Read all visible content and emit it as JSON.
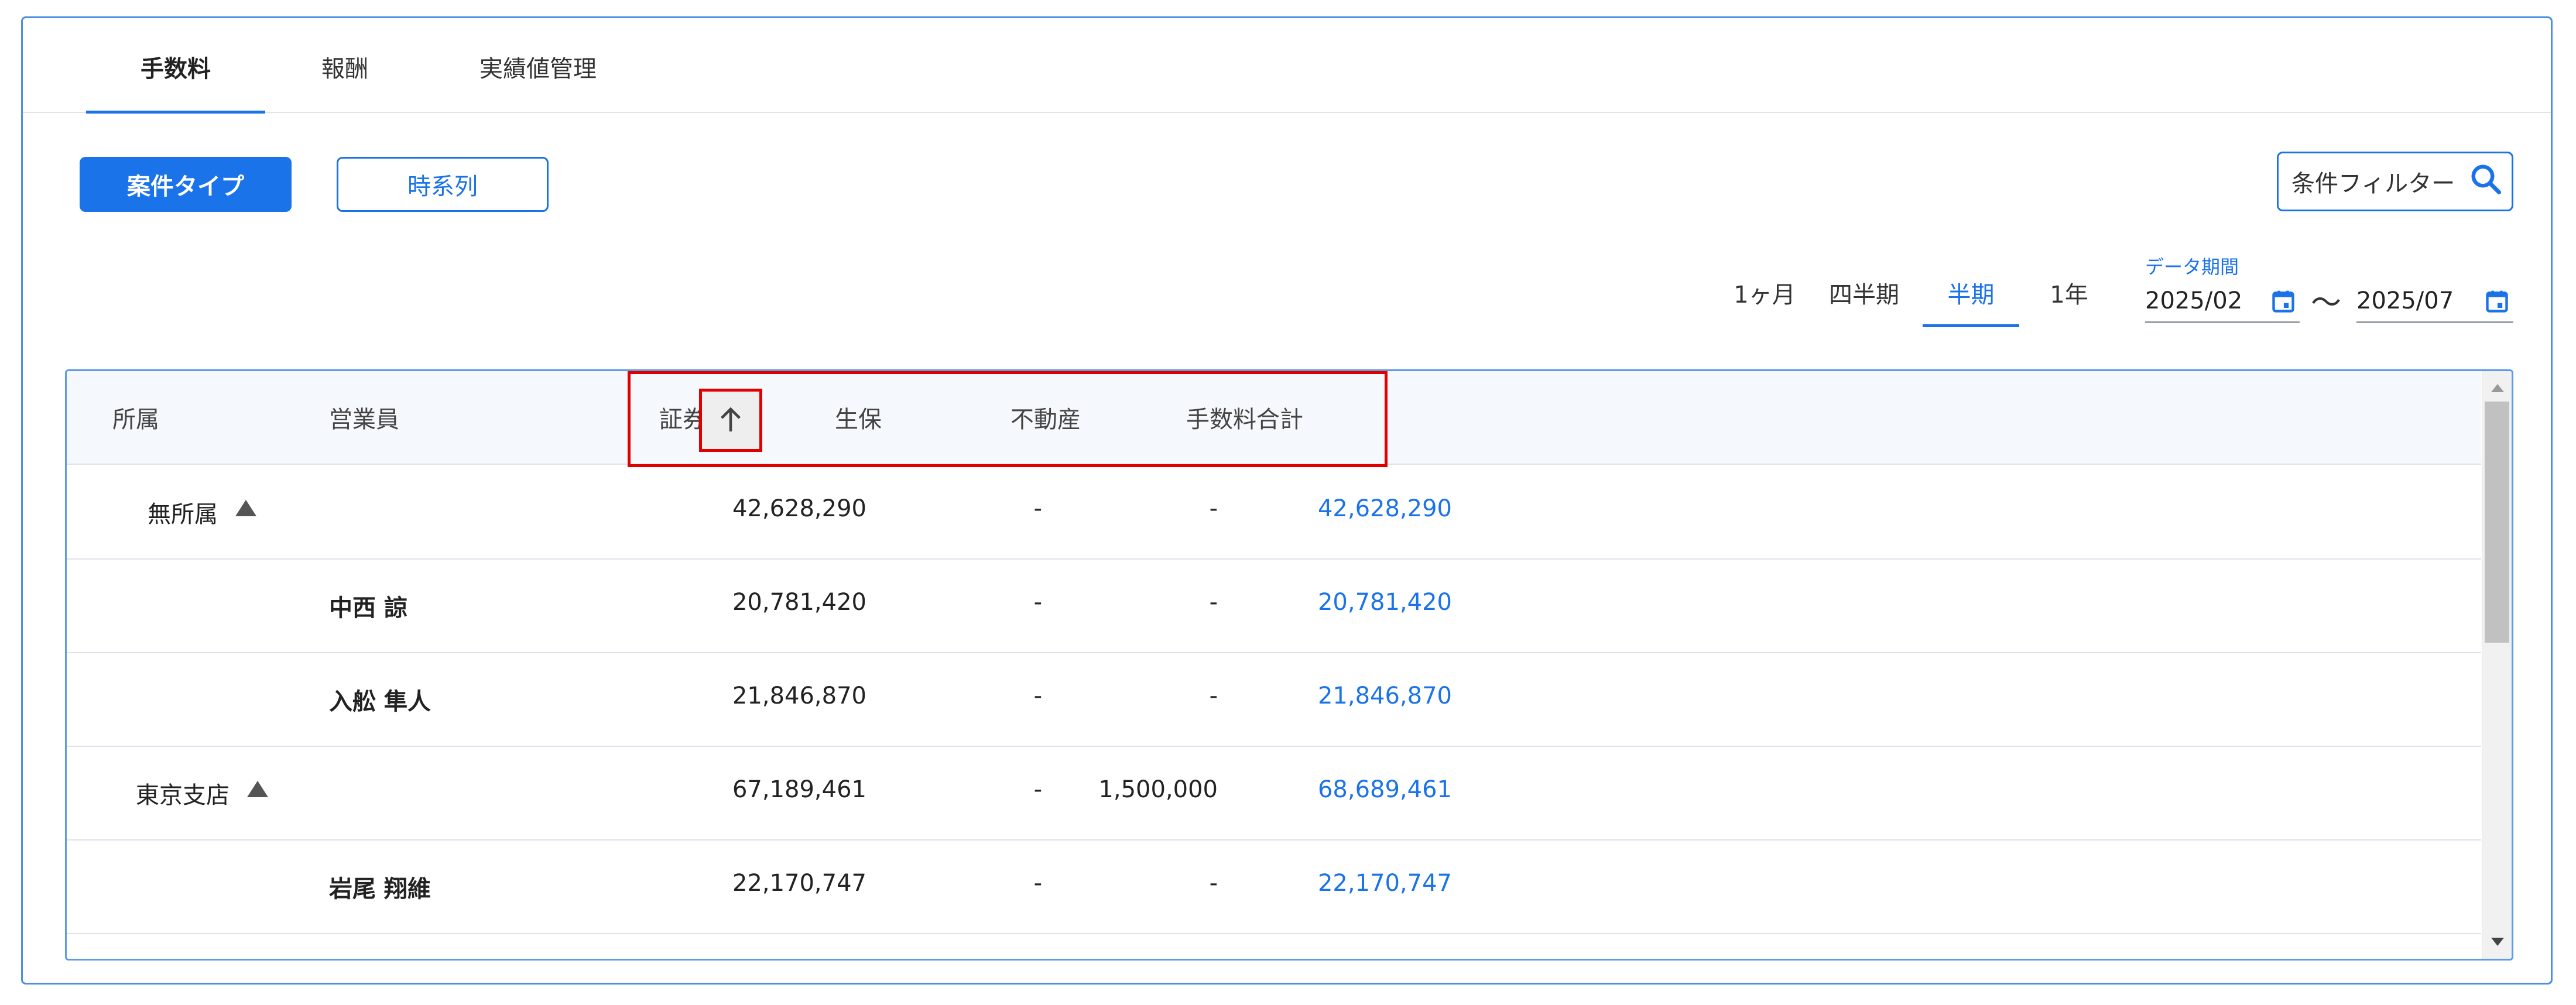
{
  "tabs": [
    {
      "label": "手数料",
      "active": true
    },
    {
      "label": "報酬",
      "active": false
    },
    {
      "label": "実績値管理",
      "active": false
    }
  ],
  "view_toggle": {
    "primary": "案件タイプ",
    "secondary": "時系列"
  },
  "filter": {
    "label": "条件フィルター",
    "icon": "search-icon"
  },
  "periods": [
    {
      "label": "1ヶ月",
      "active": false
    },
    {
      "label": "四半期",
      "active": false
    },
    {
      "label": "半期",
      "active": true
    },
    {
      "label": "1年",
      "active": false
    }
  ],
  "date_range": {
    "label": "データ期間",
    "from": "2025/02",
    "separator": "〜",
    "to": "2025/07"
  },
  "table": {
    "headers": {
      "affiliation": "所属",
      "salesperson": "営業員",
      "securities": "証券",
      "insurance": "生保",
      "real_estate": "不動産",
      "total": "手数料合計"
    },
    "sort": {
      "column": "securities",
      "direction": "asc",
      "icon": "arrow-up-icon"
    },
    "rows": [
      {
        "affiliation": "無所属",
        "salesperson": "",
        "securities": "42,628,290",
        "insurance": "-",
        "real_estate": "-",
        "total": "42,628,290",
        "group": true
      },
      {
        "affiliation": "",
        "salesperson": "中西 諒",
        "securities": "20,781,420",
        "insurance": "-",
        "real_estate": "-",
        "total": "20,781,420",
        "group": false
      },
      {
        "affiliation": "",
        "salesperson": "入舩 隼人",
        "securities": "21,846,870",
        "insurance": "-",
        "real_estate": "-",
        "total": "21,846,870",
        "group": false
      },
      {
        "affiliation": "東京支店",
        "salesperson": "",
        "securities": "67,189,461",
        "insurance": "-",
        "real_estate": "1,500,000",
        "total": "68,689,461",
        "group": true
      },
      {
        "affiliation": "",
        "salesperson": "岩尾 翔維",
        "securities": "22,170,747",
        "insurance": "-",
        "real_estate": "-",
        "total": "22,170,747",
        "group": false
      }
    ]
  },
  "colors": {
    "accent": "#1a73e8",
    "highlight": "#e00000",
    "border": "#4d8fe3"
  }
}
